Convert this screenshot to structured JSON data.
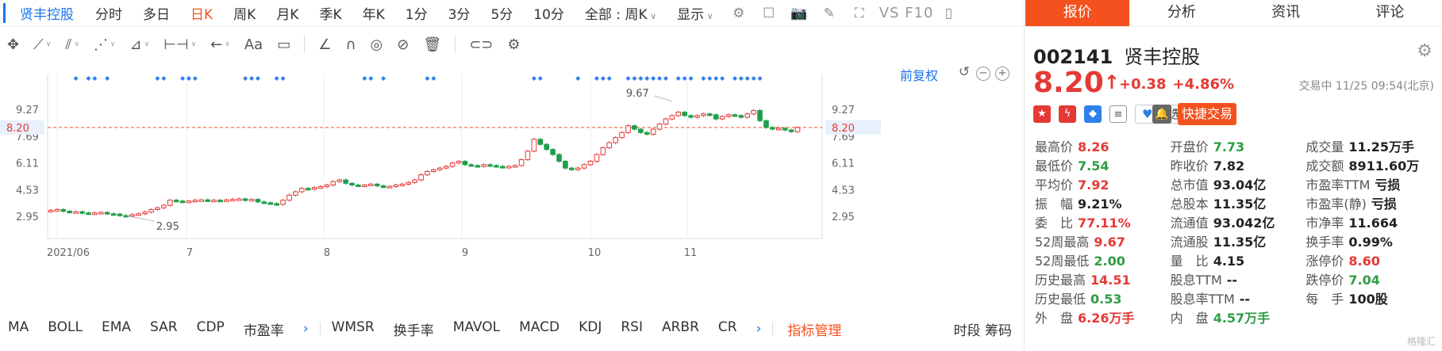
{
  "periodbar": {
    "stock_name": "贤丰控股",
    "periods": [
      "分时",
      "多日",
      "日K",
      "周K",
      "月K",
      "季K",
      "年K",
      "1分",
      "3分",
      "5分",
      "10分"
    ],
    "active_period": "日K",
    "full_select": "全部 : 周K",
    "display_label": "显示",
    "vs_f10": "VS F10"
  },
  "chart": {
    "restore_label": "前复权",
    "y_ticks": [
      "9.27",
      "7.69",
      "6.11",
      "4.53",
      "2.95"
    ],
    "current_price_label": "8.20",
    "high_annotation": "9.67",
    "low_annotation": "2.95",
    "x_labels": [
      "2021/06",
      "7",
      "8",
      "9",
      "10",
      "11"
    ]
  },
  "chart_data": {
    "type": "candlestick",
    "title": "",
    "ylim": [
      2.95,
      9.27
    ],
    "current_price": 8.2,
    "max_marker": 9.67,
    "min_marker": 2.95,
    "closes": [
      3.3,
      3.35,
      3.25,
      3.2,
      3.22,
      3.15,
      3.12,
      3.15,
      3.18,
      3.1,
      3.08,
      3.0,
      2.98,
      3.05,
      3.1,
      3.2,
      3.35,
      3.45,
      3.6,
      3.9,
      3.85,
      3.8,
      3.85,
      3.9,
      3.92,
      3.88,
      3.9,
      3.87,
      3.92,
      3.95,
      3.98,
      3.9,
      3.95,
      3.8,
      3.75,
      3.7,
      3.65,
      3.9,
      4.2,
      4.4,
      4.6,
      4.55,
      4.65,
      4.7,
      4.8,
      5.0,
      5.1,
      4.9,
      4.8,
      4.75,
      4.8,
      4.85,
      4.75,
      4.7,
      4.72,
      4.8,
      4.85,
      4.95,
      5.1,
      5.4,
      5.6,
      5.7,
      5.8,
      5.9,
      6.1,
      6.2,
      6.0,
      5.95,
      5.9,
      6.0,
      5.95,
      5.9,
      5.85,
      5.9,
      5.95,
      6.3,
      6.8,
      7.5,
      7.2,
      6.9,
      6.6,
      6.2,
      5.8,
      5.7,
      5.8,
      6.0,
      6.2,
      6.6,
      7.0,
      7.3,
      7.6,
      7.9,
      8.3,
      8.1,
      7.9,
      7.8,
      8.1,
      8.4,
      8.7,
      8.9,
      9.1,
      8.9,
      8.8,
      8.9,
      9.0,
      8.95,
      8.7,
      8.85,
      8.95,
      8.9,
      8.8,
      9.0,
      9.2,
      8.6,
      8.2,
      8.1,
      8.15,
      8.05,
      7.95,
      8.2
    ],
    "signal_dots_at": [
      4,
      6,
      7,
      9,
      17,
      18,
      21,
      22,
      23,
      31,
      32,
      33,
      36,
      37,
      50,
      51,
      53,
      60,
      61,
      77,
      78,
      84,
      87,
      88,
      89,
      92,
      93,
      94,
      95,
      96,
      97,
      98,
      100,
      101,
      102,
      104,
      105,
      106,
      107,
      109,
      110,
      111,
      112,
      113
    ]
  },
  "toolbar_icons": [
    "crosshair-icon",
    "line-icon",
    "channel-icon",
    "wave-icon",
    "fib-icon",
    "range-icon",
    "arrow-icon",
    "text-icon",
    "comment-icon",
    "angle-icon",
    "magnet-icon",
    "eye-icon",
    "hide-icon",
    "trash-icon",
    "link-icon",
    "settings-icon"
  ],
  "indicators": {
    "group1": [
      "MA",
      "BOLL",
      "EMA",
      "SAR",
      "CDP",
      "市盈率"
    ],
    "group2": [
      "WMSR",
      "换手率",
      "MAVOL",
      "MACD",
      "KDJ",
      "RSI",
      "ARBR",
      "CR"
    ],
    "manage_label": "指标管理",
    "tail": "时段 筹码"
  },
  "quote": {
    "tabs": [
      "报价",
      "分析",
      "资讯",
      "评论"
    ],
    "active_tab": "报价",
    "code": "002141",
    "name": "贤丰控股",
    "price": "8.20",
    "change": "+0.38",
    "change_pct": "+4.86%",
    "status": "交易中 11/25 09:54(北京)",
    "favorite_label": "自选",
    "quick_trade_label": "快捷交易",
    "stats": [
      [
        {
          "l": "最高价",
          "v": "8.26",
          "c": "red"
        },
        {
          "l": "开盘价",
          "v": "7.73",
          "c": "green"
        },
        {
          "l": "成交量",
          "v": "11.25万手",
          "c": "dark"
        }
      ],
      [
        {
          "l": "最低价",
          "v": "7.54",
          "c": "green"
        },
        {
          "l": "昨收价",
          "v": "7.82",
          "c": "dark"
        },
        {
          "l": "成交额",
          "v": "8911.60万",
          "c": "dark"
        }
      ],
      [
        {
          "l": "平均价",
          "v": "7.92",
          "c": "red"
        },
        {
          "l": "总市值",
          "v": "93.04亿",
          "c": "dark"
        },
        {
          "l": "市盈率TTM",
          "v": "亏损",
          "c": "dark"
        }
      ],
      [
        {
          "l": "振　幅",
          "v": "9.21%",
          "c": "dark"
        },
        {
          "l": "总股本",
          "v": "11.35亿",
          "c": "dark"
        },
        {
          "l": "市盈率(静)",
          "v": "亏损",
          "c": "dark"
        }
      ],
      [
        {
          "l": "委　比",
          "v": "77.11%",
          "c": "red"
        },
        {
          "l": "流通值",
          "v": "93.042亿",
          "c": "dark"
        },
        {
          "l": "市净率",
          "v": "11.664",
          "c": "dark"
        }
      ],
      [
        {
          "l": "52周最高",
          "v": "9.67",
          "c": "red"
        },
        {
          "l": "流通股",
          "v": "11.35亿",
          "c": "dark"
        },
        {
          "l": "换手率",
          "v": "0.99%",
          "c": "dark"
        }
      ],
      [
        {
          "l": "52周最低",
          "v": "2.00",
          "c": "green"
        },
        {
          "l": "量　比",
          "v": "4.15",
          "c": "dark"
        },
        {
          "l": "涨停价",
          "v": "8.60",
          "c": "red"
        }
      ],
      [
        {
          "l": "历史最高",
          "v": "14.51",
          "c": "red"
        },
        {
          "l": "股息TTM",
          "v": "--",
          "c": "dark"
        },
        {
          "l": "跌停价",
          "v": "7.04",
          "c": "green"
        }
      ],
      [
        {
          "l": "历史最低",
          "v": "0.53",
          "c": "green"
        },
        {
          "l": "股息率TTM",
          "v": "--",
          "c": "dark"
        },
        {
          "l": "每　手",
          "v": "100股",
          "c": "dark"
        }
      ],
      [
        {
          "l": "外　盘",
          "v": "6.26万手",
          "c": "red"
        },
        {
          "l": "内　盘",
          "v": "4.57万手",
          "c": "green"
        },
        {
          "l": "",
          "v": "",
          "c": "dark"
        }
      ]
    ],
    "watermark": "格隆汇"
  }
}
